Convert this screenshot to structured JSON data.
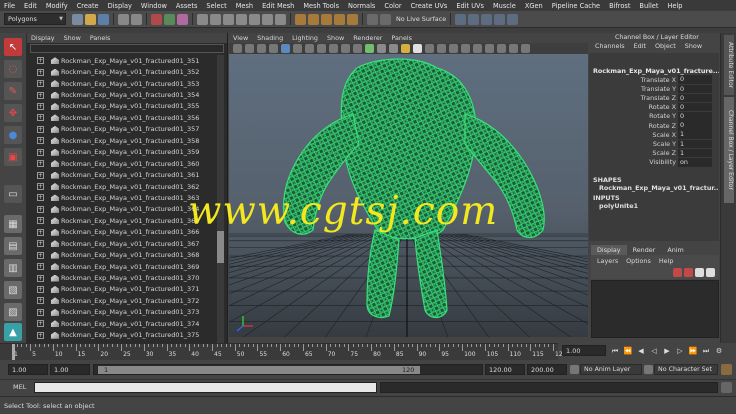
{
  "menu_bar": [
    "File",
    "Edit",
    "Modify",
    "Create",
    "Display",
    "Window",
    "Assets",
    "Select",
    "Mesh",
    "Edit Mesh",
    "Mesh Tools",
    "Normals",
    "Color",
    "Create UVs",
    "Edit UVs",
    "Muscle",
    "XGen",
    "Pipeline Cache",
    "Bifrost",
    "Bullet",
    "Help"
  ],
  "status_line": {
    "menu_set": "Polygons",
    "live_surface": "No Live Surface"
  },
  "outliner": {
    "menu": [
      "Display",
      "Show",
      "Panels"
    ],
    "items": [
      "Rockman_Exp_Maya_v01_fractured01_351",
      "Rockman_Exp_Maya_v01_fractured01_352",
      "Rockman_Exp_Maya_v01_fractured01_353",
      "Rockman_Exp_Maya_v01_fractured01_354",
      "Rockman_Exp_Maya_v01_fractured01_355",
      "Rockman_Exp_Maya_v01_fractured01_356",
      "Rockman_Exp_Maya_v01_fractured01_357",
      "Rockman_Exp_Maya_v01_fractured01_358",
      "Rockman_Exp_Maya_v01_fractured01_359",
      "Rockman_Exp_Maya_v01_fractured01_360",
      "Rockman_Exp_Maya_v01_fractured01_361",
      "Rockman_Exp_Maya_v01_fractured01_362",
      "Rockman_Exp_Maya_v01_fractured01_363",
      "Rockman_Exp_Maya_v01_fractured01_364",
      "Rockman_Exp_Maya_v01_fractured01_365",
      "Rockman_Exp_Maya_v01_fractured01_366",
      "Rockman_Exp_Maya_v01_fractured01_367",
      "Rockman_Exp_Maya_v01_fractured01_368",
      "Rockman_Exp_Maya_v01_fractured01_369",
      "Rockman_Exp_Maya_v01_fractured01_370",
      "Rockman_Exp_Maya_v01_fractured01_371",
      "Rockman_Exp_Maya_v01_fractured01_372",
      "Rockman_Exp_Maya_v01_fractured01_373",
      "Rockman_Exp_Maya_v01_fractured01_374",
      "Rockman_Exp_Maya_v01_fractured01_375"
    ]
  },
  "viewport": {
    "menu": [
      "View",
      "Shading",
      "Lighting",
      "Show",
      "Renderer",
      "Panels"
    ],
    "wireframe_color": "#39e07a",
    "watermark": "www.cgtsj.com"
  },
  "channel_box": {
    "title": "Channel Box / Layer Editor",
    "menu": [
      "Channels",
      "Edit",
      "Object",
      "Show"
    ],
    "object_name": "Rockman_Exp_Maya_v01_fracture...",
    "attributes": [
      {
        "name": "Translate X",
        "value": "0"
      },
      {
        "name": "Translate Y",
        "value": "0"
      },
      {
        "name": "Translate Z",
        "value": "0"
      },
      {
        "name": "Rotate X",
        "value": "0"
      },
      {
        "name": "Rotate Y",
        "value": "0"
      },
      {
        "name": "Rotate Z",
        "value": "0"
      },
      {
        "name": "Scale X",
        "value": "1"
      },
      {
        "name": "Scale Y",
        "value": "1"
      },
      {
        "name": "Scale Z",
        "value": "1"
      },
      {
        "name": "Visibility",
        "value": "on"
      }
    ],
    "shapes_label": "SHAPES",
    "shapes_value": "Rockman_Exp_Maya_v01_fractur...",
    "inputs_label": "INPUTS",
    "inputs_value": "polyUnite1"
  },
  "side_tabs": [
    "Attribute Editor",
    "Channel Box / Layer Editor"
  ],
  "layer_editor": {
    "tabs": [
      "Display",
      "Render",
      "Anim"
    ],
    "menu": [
      "Layers",
      "Options",
      "Help"
    ]
  },
  "time_slider": {
    "ticks": [
      "1",
      "5",
      "10",
      "15",
      "20",
      "25",
      "30",
      "35",
      "40",
      "45",
      "50",
      "55",
      "60",
      "65",
      "70",
      "75",
      "80",
      "85",
      "90",
      "95",
      "100",
      "105",
      "110",
      "115",
      "120"
    ],
    "current_frame": "1.00"
  },
  "range_slider": {
    "start_time": "1.00",
    "playback_start": "1.00",
    "range_start_label": "1",
    "range_end_label": "120",
    "playback_end": "120.00",
    "end_time": "200.00",
    "anim_layer": "No Anim Layer",
    "character_set": "No Character Set"
  },
  "command_line": {
    "label": "MEL"
  },
  "help_line": {
    "text": "Select Tool: select an object"
  }
}
